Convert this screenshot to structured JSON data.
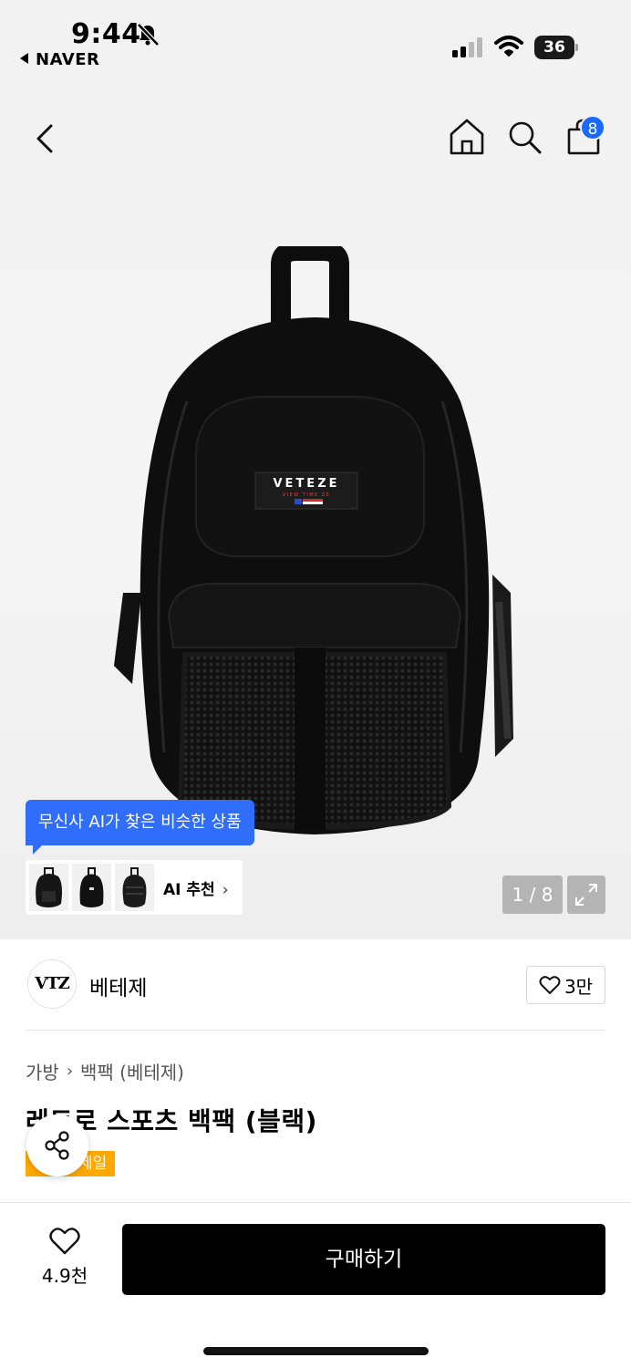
{
  "status_bar": {
    "time": "9:44",
    "back_app": "NAVER",
    "battery": "36"
  },
  "header": {
    "cart_count": "8"
  },
  "gallery": {
    "image_counter": "1 / 8",
    "ai_bubble": "무신사 AI가 찾은 비슷한 상품",
    "ai_recommend_label": "AI 추천",
    "product_logo_text": "VETEZE",
    "product_logo_subtext": "VIEW TIME ZE"
  },
  "brand": {
    "logo_text": "VTZ",
    "name": "베테제",
    "like_count": "3만"
  },
  "product": {
    "breadcrumb": [
      "가방",
      "백팩 (베테제)"
    ],
    "title": "레트로 스포츠 백팩 (블랙)",
    "sale_tag": "세일"
  },
  "bottom_bar": {
    "like_count": "4.9천",
    "buy_label": "구매하기"
  },
  "colors": {
    "accent_blue": "#2f6dfa",
    "badge_blue": "#1769ff",
    "sale_orange": "#ffa800",
    "buy_black": "#000000"
  }
}
